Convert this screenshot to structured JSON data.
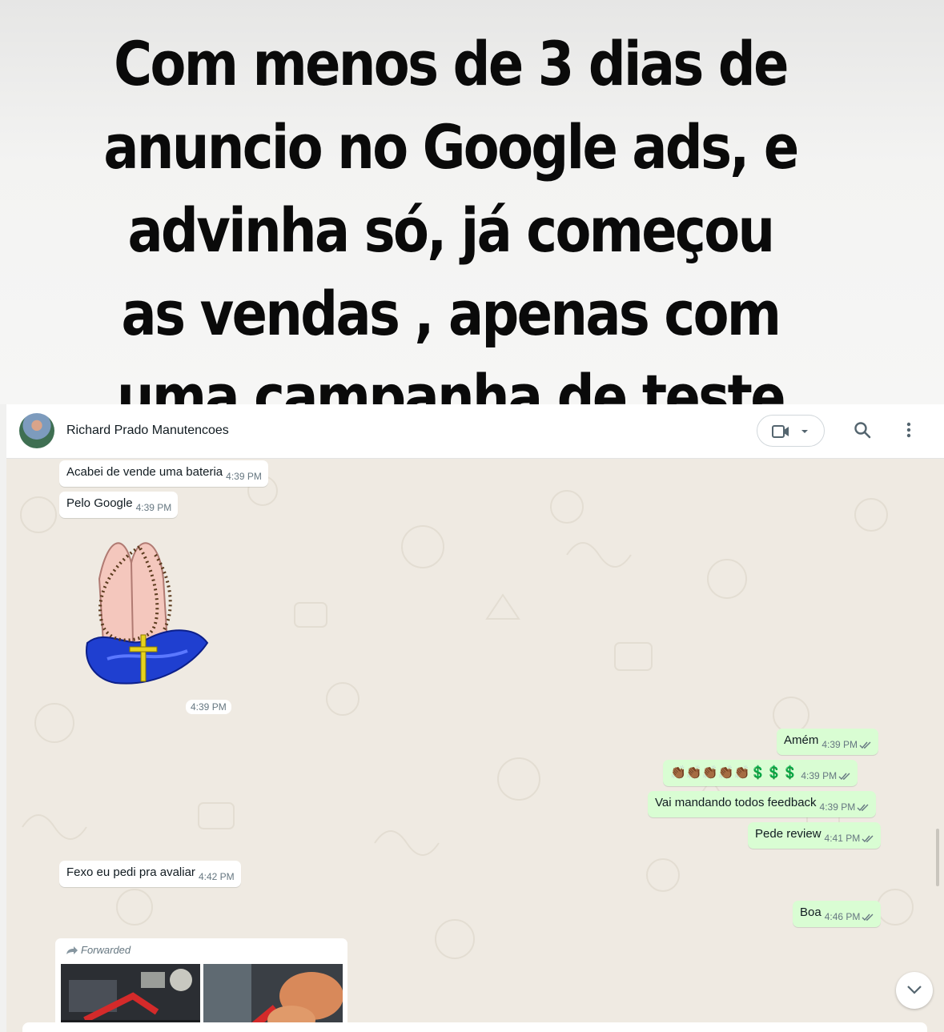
{
  "headline": "Com menos de 3 dias de anuncio no Google ads, e advinha só, já começou as vendas , apenas com uma campanha de teste",
  "header": {
    "contact_name": "Richard Prado Manutencoes",
    "icons": [
      "avatar",
      "video-call-icon",
      "dropdown-arrow-icon",
      "search-icon",
      "more-options-icon"
    ]
  },
  "messages": [
    {
      "direction": "in",
      "text": "Acabei de vende uma bateria",
      "time": "4:39 PM"
    },
    {
      "direction": "in",
      "text": "Pelo Google",
      "time": "4:39 PM"
    },
    {
      "direction": "in",
      "type": "sticker",
      "sticker": "praying-hands-rosary",
      "time": "4:39 PM"
    },
    {
      "direction": "out",
      "text": "Amém",
      "time": "4:39 PM",
      "status": "read"
    },
    {
      "direction": "out",
      "text": "👏🏾👏🏾👏🏾👏🏾👏🏾💲💲💲",
      "time": "4:39 PM",
      "status": "read"
    },
    {
      "direction": "out",
      "text": "Vai mandando todos feedback",
      "time": "4:39 PM",
      "status": "read"
    },
    {
      "direction": "out",
      "text": "Pede review",
      "time": "4:41 PM",
      "status": "read"
    },
    {
      "direction": "in",
      "text": "Fexo eu pedi pra avaliar",
      "time": "4:42 PM"
    },
    {
      "direction": "out",
      "text": "Boa",
      "time": "4:46 PM",
      "status": "read"
    }
  ],
  "forwarded": {
    "label": "Forwarded",
    "photos": 2
  },
  "colors": {
    "chat_background": "#efeae2",
    "incoming_bubble": "#ffffff",
    "outgoing_bubble": "#d9fdd3",
    "read_ticks": "#667781"
  }
}
